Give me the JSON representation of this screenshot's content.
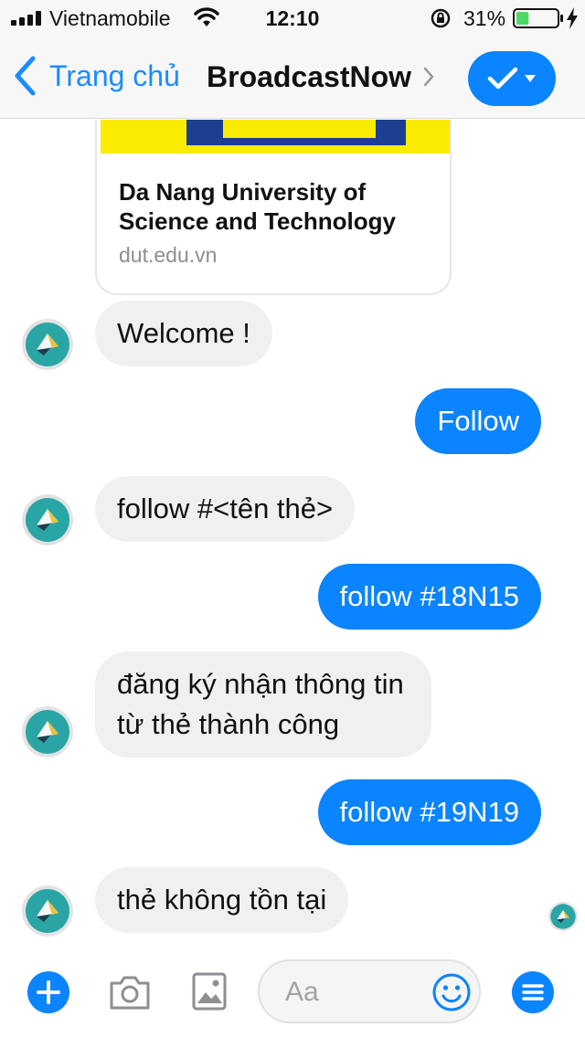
{
  "status_bar": {
    "carrier": "Vietnamobile",
    "time": "12:10",
    "battery_percent": "31%",
    "battery_level": 0.31
  },
  "nav": {
    "back_label": "Trang chủ",
    "title": "BroadcastNow"
  },
  "link_preview": {
    "title": "Da Nang University of Science and Technology",
    "domain": "dut.edu.vn"
  },
  "messages": [
    {
      "from": "bot",
      "text": "Welcome !"
    },
    {
      "from": "me",
      "text": "Follow"
    },
    {
      "from": "bot",
      "text": "follow #<tên thẻ>"
    },
    {
      "from": "me",
      "text": "follow #18N15"
    },
    {
      "from": "bot",
      "text": "đăng ký nhận thông tin từ thẻ thành công"
    },
    {
      "from": "me",
      "text": "follow #19N19"
    },
    {
      "from": "bot",
      "text": "thẻ không tồn tại"
    }
  ],
  "composer": {
    "placeholder": "Aa"
  },
  "colors": {
    "accent": "#0a84ff",
    "link": "#1a8cff",
    "bot_bubble": "#f0f0f0",
    "bot_avatar": "#2aa5a5"
  },
  "icons": [
    "signal-icon",
    "wifi-icon",
    "orientation-lock-icon",
    "battery-icon",
    "charging-icon",
    "back-chevron-icon",
    "chevron-right-icon",
    "check-icon",
    "caret-down-icon",
    "bot-avatar-icon",
    "plus-icon",
    "camera-icon",
    "gallery-icon",
    "emoji-icon",
    "menu-icon"
  ]
}
